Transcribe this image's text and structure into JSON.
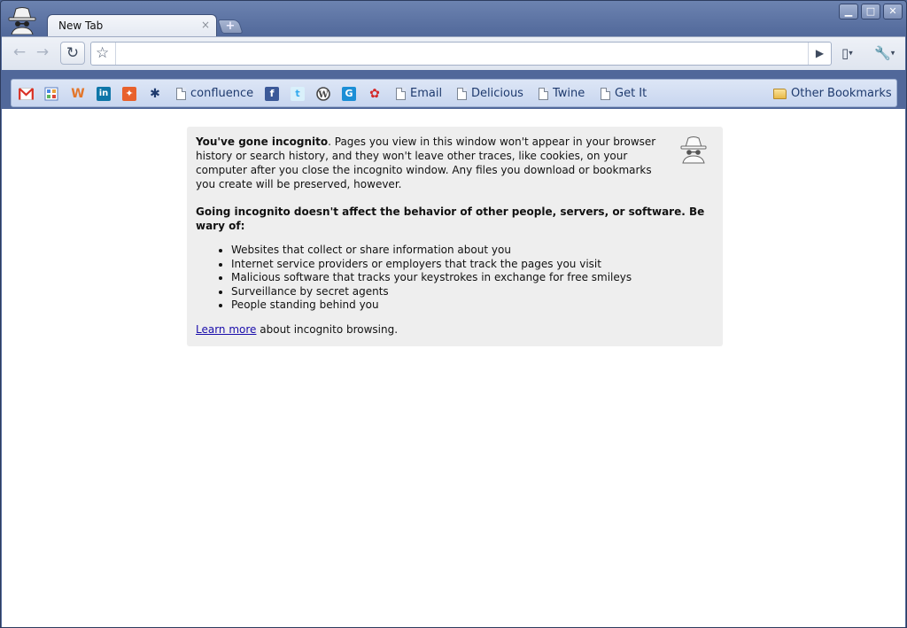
{
  "tab": {
    "title": "New Tab",
    "close": "×",
    "new_tab": "+"
  },
  "window_buttons": {
    "minimize": "▁",
    "maximize": "□",
    "close": "✕"
  },
  "toolbar": {
    "back": "←",
    "forward": "→",
    "reload": "↻",
    "star": "☆",
    "omnibox_value": "",
    "go": "▶",
    "page_menu": "▯",
    "wrench": "🔧",
    "caret": "▾"
  },
  "bookmarks": {
    "confluence": "confluence",
    "email": "Email",
    "delicious": "Delicious",
    "twine": "Twine",
    "getit": "Get It",
    "other": "Other Bookmarks"
  },
  "incognito": {
    "lead_bold": "You've gone incognito",
    "lead_rest": ". Pages you view in this window won't appear in your browser history or search history, and they won't leave other traces, like cookies, on your computer after you close the incognito window. Any files you download or bookmarks you create will be preserved, however.",
    "warning": "Going incognito doesn't affect the behavior of other people, servers, or software. Be wary of:",
    "items": [
      "Websites that collect or share information about you",
      "Internet service providers or employers that track the pages you visit",
      "Malicious software that tracks your keystrokes in exchange for free smileys",
      "Surveillance by secret agents",
      "People standing behind you"
    ],
    "learn_link": "Learn more",
    "learn_rest": " about incognito browsing."
  },
  "colors": {
    "frame": "#51689a",
    "bookmark_bar": "#c8d6ef",
    "incognito_box": "#eeeeee",
    "link": "#1a0dab"
  }
}
